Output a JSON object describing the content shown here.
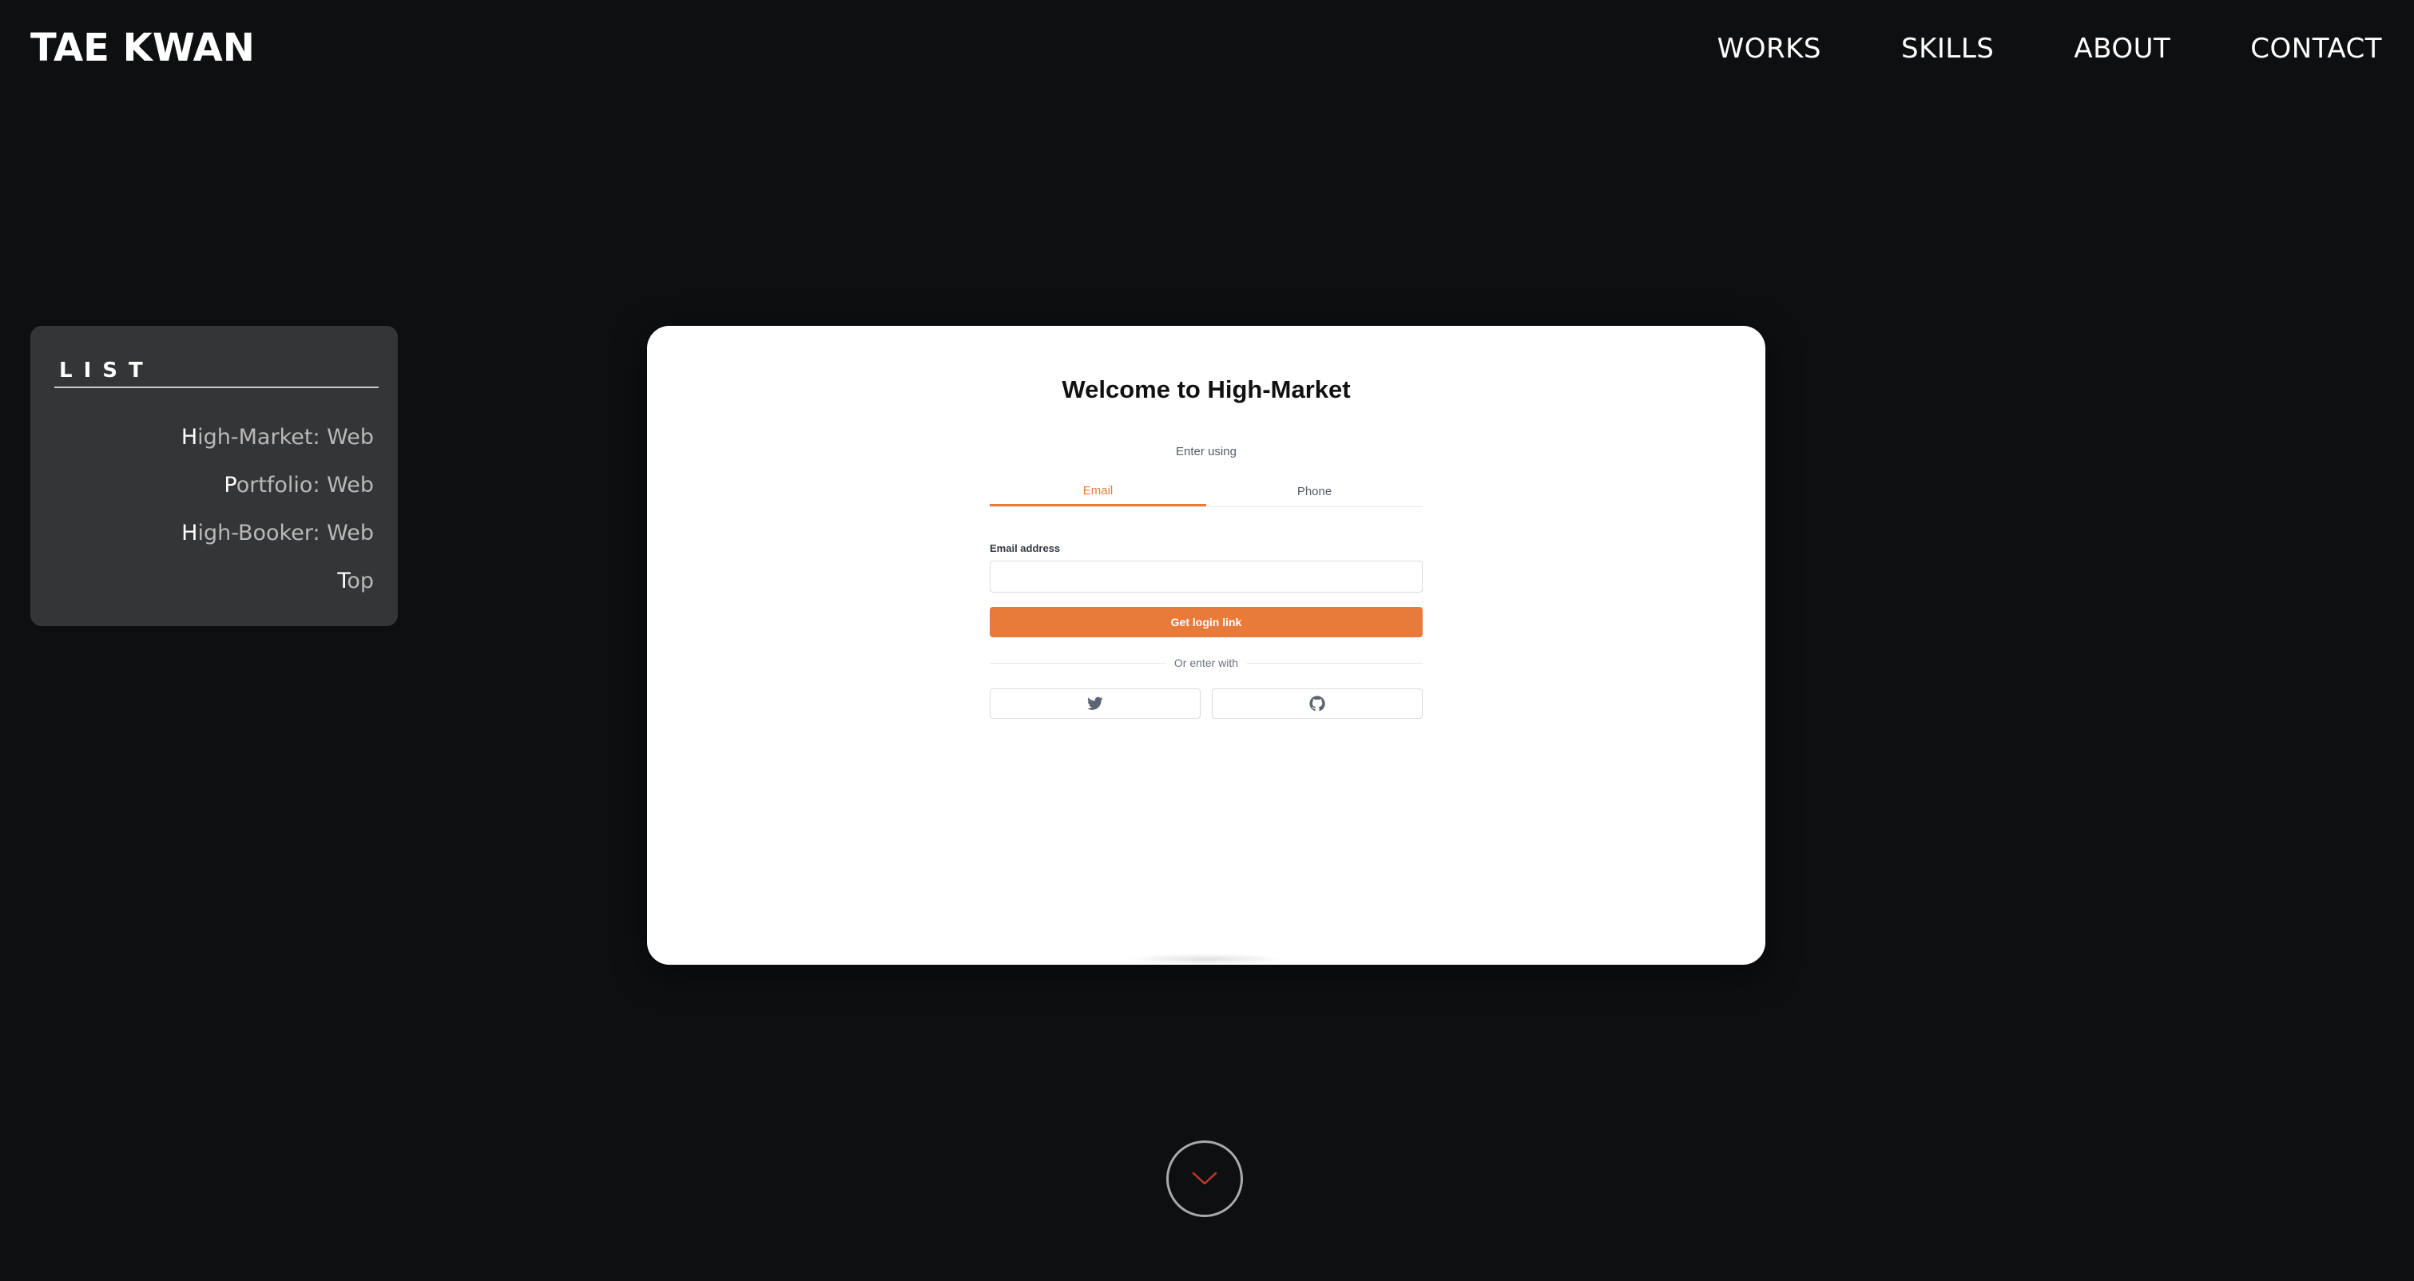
{
  "header": {
    "brand": "TAE KWAN",
    "nav": [
      "WORKS",
      "SKILLS",
      "ABOUT",
      "CONTACT"
    ]
  },
  "list": {
    "title": "LIST",
    "items": [
      {
        "first": "H",
        "rest": "igh-Market: Web"
      },
      {
        "first": "P",
        "rest": "ortfolio: Web"
      },
      {
        "first": "H",
        "rest": "igh-Booker: Web"
      },
      {
        "first": "T",
        "rest": "op"
      }
    ]
  },
  "preview": {
    "title": "Welcome to High-Market",
    "enter_using": "Enter using",
    "tabs": [
      {
        "label": "Email",
        "active": true
      },
      {
        "label": "Phone",
        "active": false
      }
    ],
    "email_label": "Email address",
    "email_value": "",
    "button_label": "Get login link",
    "divider_text": "Or enter with",
    "social": [
      "twitter-icon",
      "github-icon"
    ]
  },
  "colors": {
    "background": "#0e0f11",
    "panel": "#343536",
    "accent": "#e97b3a",
    "scroll_arrow": "#c0392b"
  },
  "icons": {
    "scroll": "chevron-down-icon"
  }
}
